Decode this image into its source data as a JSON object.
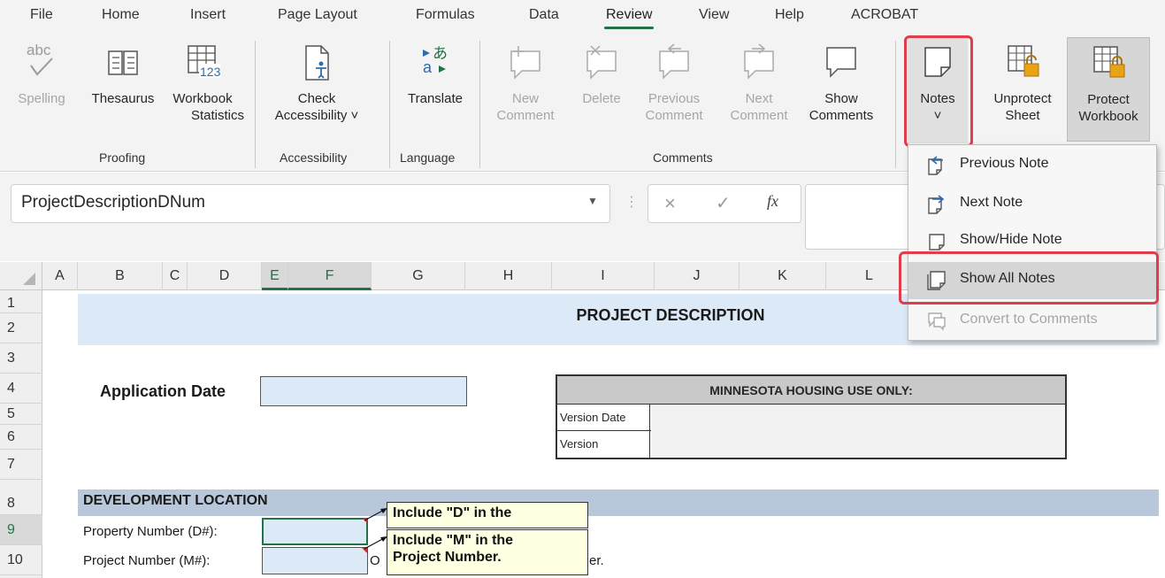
{
  "menu": {
    "tabs": [
      "File",
      "Home",
      "Insert",
      "Page Layout",
      "Formulas",
      "Data",
      "Review",
      "View",
      "Help",
      "ACROBAT"
    ],
    "active_tab": "Review"
  },
  "ribbon": {
    "spelling": {
      "line1": "Spelling",
      "icon_text": "abc"
    },
    "thesaurus": {
      "line1": "Thesaurus"
    },
    "workbook_statistics": {
      "line1": "Workbook",
      "line2": "Statistics",
      "icon_text": "123"
    },
    "check_accessibility": {
      "line1": "Check",
      "line2": "Accessibility ˅"
    },
    "translate": {
      "line1": "Translate"
    },
    "new_comment": {
      "line1": "New",
      "line2": "Comment"
    },
    "delete": {
      "line1": "Delete"
    },
    "previous_comment": {
      "line1": "Previous",
      "line2": "Comment"
    },
    "next_comment": {
      "line1": "Next",
      "line2": "Comment"
    },
    "show_comments": {
      "line1": "Show",
      "line2": "Comments"
    },
    "notes": {
      "line1": "Notes",
      "line2": "˅"
    },
    "unprotect_sheet": {
      "line1": "Unprotect",
      "line2": "Sheet"
    },
    "protect_workbook": {
      "line1": "Protect",
      "line2": "Workbook"
    },
    "groups": {
      "proofing": "Proofing",
      "accessibility": "Accessibility",
      "language": "Language",
      "comments": "Comments"
    }
  },
  "formula_bar": {
    "name_box": "ProjectDescriptionDNum",
    "cancel_glyph": "×",
    "enter_glyph": "✓",
    "fx_glyph": "fx"
  },
  "notes_menu": {
    "items": [
      {
        "label": "Previous Note",
        "enabled": true
      },
      {
        "label": "Next Note",
        "enabled": true
      },
      {
        "label": "Show/Hide Note",
        "enabled": true
      },
      {
        "label": "Show All Notes",
        "enabled": true,
        "highlighted": true
      },
      {
        "label": "Convert to Comments",
        "enabled": false
      }
    ]
  },
  "grid": {
    "columns": [
      "A",
      "B",
      "C",
      "D",
      "E",
      "F",
      "G",
      "H",
      "I",
      "J",
      "K",
      "L"
    ],
    "rows": [
      "1",
      "2",
      "3",
      "4",
      "5",
      "6",
      "7",
      "8",
      "9",
      "10"
    ]
  },
  "sheet": {
    "title": "PROJECT DESCRIPTION",
    "application_date_label": "Application Date",
    "mh_table": {
      "header": "MINNESOTA HOUSING USE ONLY:",
      "row1": "Version Date",
      "row2": "Version"
    },
    "dev_location": "DEVELOPMENT LOCATION",
    "property_number_label": "Property Number (D#):",
    "project_number_label": "Project Number (M#):",
    "note1": "Include \"D\" in the",
    "note2_line1": "Include \"M\" in the",
    "note2_line2": "Project Number.",
    "trailing_o": "O",
    "trailing_er": "er."
  },
  "colors": {
    "accent_green": "#217346",
    "highlight_red": "#e03c4b",
    "header_blue": "#dce9f7",
    "note_yellow": "#ffffe1"
  }
}
